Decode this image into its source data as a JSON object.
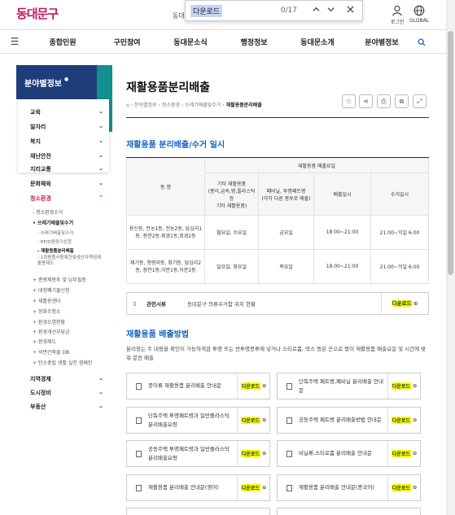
{
  "header": {
    "logo": "동대문구",
    "site_label": "동대",
    "login": "로그인",
    "global": "GLOBAL"
  },
  "find_bar": {
    "query": "다운로드",
    "count": "0/17",
    "up": "⌃",
    "down": "⌄",
    "close": "✕"
  },
  "gnb": {
    "menu_icon": "☰",
    "items": [
      "종합민원",
      "구민참여",
      "동대문소식",
      "행정정보",
      "동대문소개",
      "분야별정보"
    ],
    "search_icon": "search-icon"
  },
  "left_nav": {
    "title": "분야별정보",
    "items": [
      {
        "label": "교육",
        "mark": "⌄"
      },
      {
        "label": "일자리",
        "mark": "⌄"
      },
      {
        "label": "복지",
        "mark": "⌄"
      },
      {
        "label": "재난안전",
        "mark": "⌄"
      },
      {
        "label": "지리교통",
        "mark": "⌄"
      },
      {
        "label": "문화체육",
        "mark": "⌄"
      },
      {
        "label": "청소환경",
        "mark": "⌃"
      }
    ],
    "sub": [
      "청소환경소식",
      "쓰레기배출및수거"
    ],
    "sub2": [
      "쓰레기배출및수거",
      "RFID종량기신청",
      "재활용품분리배출",
      "1회용품사용제한및생산자책임재활용제도"
    ],
    "sub3": [
      "종량제봉투 및 납부필증",
      "대형폐기물신청",
      "재활용센터",
      "정화조청소",
      "환경오염현황",
      "환경개선부담금",
      "환경제도",
      "석면건축물 DB",
      "탄소중립 생활 실천 캠페인"
    ],
    "bottom": [
      {
        "label": "지역경제",
        "mark": "⌄"
      },
      {
        "label": "도시정비",
        "mark": "⌄"
      },
      {
        "label": "부동산",
        "mark": "⌄"
      }
    ]
  },
  "page": {
    "title": "재활용품분리배출",
    "breadcrumb": [
      "분야별정보",
      "청소환경",
      "쓰레기배출및수거",
      "재활용품분리배출"
    ]
  },
  "schedule": {
    "heading": "재활용품 분리배출/수거 일시",
    "col_dong": "동 명",
    "col_group": "재활용품 배출요일",
    "cols": [
      "기타 재활용품\n(종이,금속,병,플라스틱 등\n기타 재활용품)",
      "폐비닐, 투명페트병\n(각각 다른 봉투로 배출)",
      "배출일시",
      "수거일시"
    ],
    "rows": [
      {
        "dong": "용신동, 전농1동, 전농2동, 답십리1동, 장안2동,휘경1동,회경2동",
        "etc": "월요일, 수요일",
        "vinyl": "금요일",
        "out": "18:00~21:00",
        "collect": "21:00~익일 6:00"
      },
      {
        "dong": "제기동, 청량리동, 회기동, 답십리2동, 장안1동,이문1동,이문2동",
        "etc": "일요일, 화요일",
        "vinyl": "목요일",
        "out": "18:00~21:00",
        "collect": "21:00~익일 6:00"
      }
    ]
  },
  "related": {
    "label": "관련서류",
    "doc": "동대문구 의류수거함 위치 현황",
    "download": "다운로드"
  },
  "method": {
    "heading": "재활용품 배출방법",
    "desc": "분리정는 주 내용을 확인이 가능하게끔 투명 또는 반투명봉투에 넣거나 스티로폼, 박스 등은 끈으로 묶어 재활용품 배출요일 및 시간에 맞춰 문전 배출",
    "download": "다운로드",
    "cards": [
      "종이류 재활용품 분리배출 안내문",
      "단독주택 페트병,폐비닐 분리배출 안내문",
      "단독주택 투명페트병과 일반플라스틱 분리배출요령",
      "공동주택 페트병 분리배출방법 안내문",
      "공동주택 투명페트병과 일반플라스틱 분리배출요령",
      "비닐류,스티로폼 분리배출 안내문",
      "재활용품 분리배출 안내문(영어)",
      "재활용품 분리배출 안내문(중국어)"
    ]
  }
}
